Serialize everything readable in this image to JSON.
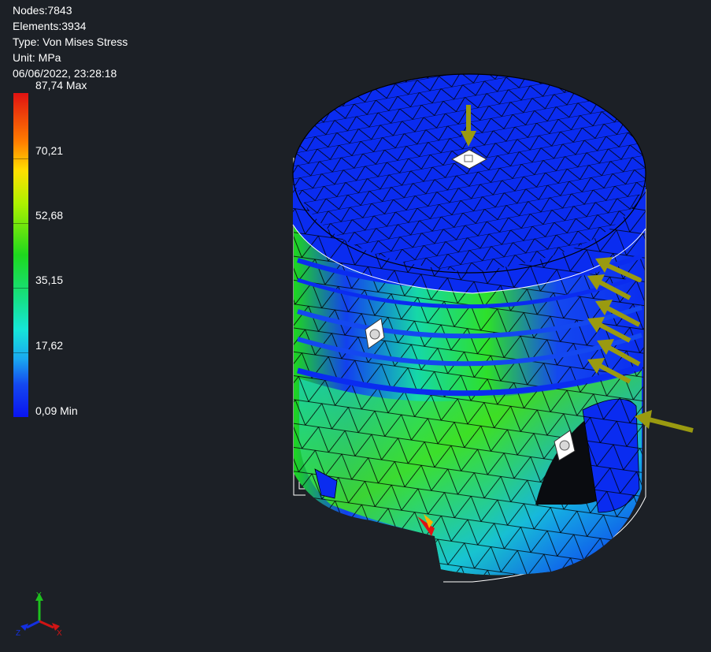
{
  "info": {
    "nodes": "Nodes:7843",
    "elements": "Elements:3934",
    "type": "Type: Von Mises Stress",
    "unit": "Unit: MPa",
    "timestamp": "06/06/2022, 23:28:18"
  },
  "legend": {
    "labels": [
      "87,74 Max",
      "70,21",
      "52,68",
      "35,15",
      "17,62",
      "0,09 Min"
    ]
  },
  "triad": {
    "x": "X",
    "y": "Y",
    "z": "Z"
  },
  "colors": {
    "background": "#1c2026",
    "low_stress": "#0a2cf0",
    "mid_stress": "#1ed81e",
    "high_stress": "#e01212",
    "load_arrow": "#9a9a10",
    "mesh": "#000000"
  },
  "icons": [
    "force-arrow-icon",
    "constraint-icon",
    "axis-triad-icon"
  ]
}
